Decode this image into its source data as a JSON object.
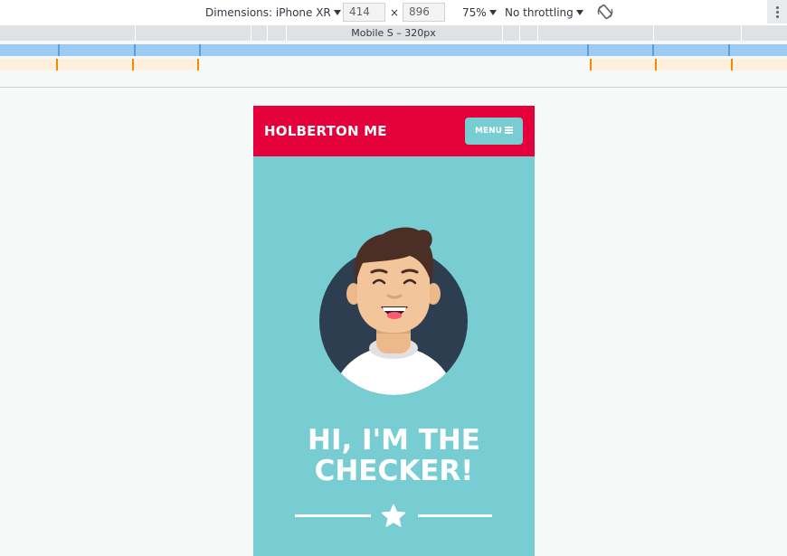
{
  "devtools": {
    "dimensions_label": "Dimensions: iPhone XR",
    "width_value": "414",
    "times": "×",
    "height_value": "896",
    "zoom": "75%",
    "throttling": "No throttling",
    "rotate_icon": "rotate-icon",
    "more_icon": "more-vert-icon",
    "media_query_label": "Mobile S – 320px"
  },
  "page": {
    "brand": "HOLBERTON ME",
    "menu_label": "MENU",
    "menu_icon": "hamburger-icon",
    "headline_line1": "HI, I'M THE",
    "headline_line2": "CHECKER!",
    "divider_icon": "star-icon"
  },
  "colors": {
    "navbar": "#e4003a",
    "hero": "#78cdd2",
    "avatar_bg": "#2c3e50",
    "text_white": "#ffffff"
  }
}
